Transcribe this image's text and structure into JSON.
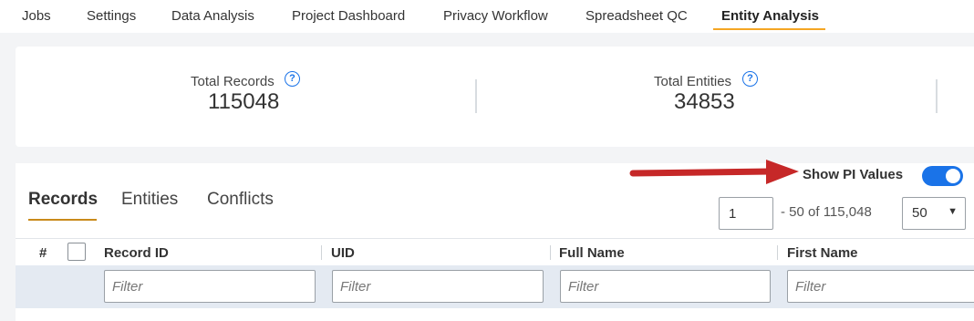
{
  "nav": {
    "tabs": [
      "Jobs",
      "Settings",
      "Data Analysis",
      "Project Dashboard",
      "Privacy Workflow",
      "Spreadsheet QC",
      "Entity Analysis"
    ],
    "active": "Entity Analysis"
  },
  "stats": {
    "total_records_label": "Total Records",
    "total_records_value": "115048",
    "total_entities_label": "Total Entities",
    "total_entities_value": "34853",
    "help_glyph": "?"
  },
  "toolbar": {
    "show_pi_label": "Show PI Values",
    "show_pi_on": true
  },
  "subtabs": [
    "Records",
    "Entities",
    "Conflicts"
  ],
  "pagination": {
    "page": "1",
    "range_text": "- 50 of 115,048",
    "page_size": "50"
  },
  "grid": {
    "row_number_header": "#",
    "columns": [
      "Record ID",
      "UID",
      "Full Name",
      "First Name"
    ],
    "filter_placeholder": "Filter"
  },
  "colors": {
    "accent": "#1a73e8",
    "tab_underline": "#f5a623",
    "annotation_arrow": "#c62828"
  },
  "icons": {
    "help": "help-circle-icon",
    "arrow": "annotation-arrow",
    "caret": "chevron-down-icon"
  }
}
